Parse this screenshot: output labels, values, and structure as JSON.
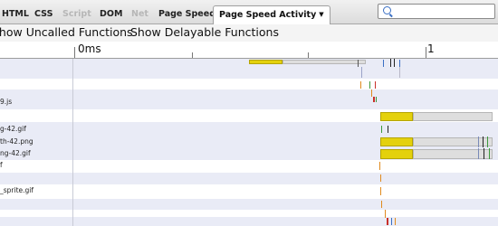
{
  "tabs": [
    {
      "label": "HTML",
      "state": "normal"
    },
    {
      "label": "CSS",
      "state": "normal"
    },
    {
      "label": "Script",
      "state": "disabled"
    },
    {
      "label": "DOM",
      "state": "normal"
    },
    {
      "label": "Net",
      "state": "disabled"
    },
    {
      "label": "Page Speed",
      "state": "normal"
    },
    {
      "label": "Page Speed Activity",
      "state": "selected"
    }
  ],
  "search": {
    "value": ""
  },
  "options": [
    {
      "label": "Show Uncalled Functions"
    },
    {
      "label": "Show Delayable Functions"
    }
  ],
  "timeline": {
    "start_label": "0ms",
    "end_label": "1",
    "rows": [
      {
        "name": ""
      },
      {
        "name": ""
      },
      {
        "name": ""
      },
      {
        "name": "9.js"
      },
      {
        "name": ""
      },
      {
        "name": "g-42.gif"
      },
      {
        "name": ""
      },
      {
        "name": "th-42.png"
      },
      {
        "name": "ng-42.gif"
      },
      {
        "name": "f"
      },
      {
        "name": ""
      },
      {
        "name": "_sprite.gif"
      },
      {
        "name": ""
      },
      {
        "name": ""
      },
      {
        "name": ""
      }
    ]
  },
  "colors": {
    "load_bar": "#e4d10c",
    "wait_bar": "#dedede",
    "row_stripe": "#e9ebf6",
    "marker_orange": "#e08a1e",
    "marker_red": "#c8302a",
    "marker_green": "#3c9a3c",
    "marker_blue": "#4a6fc4",
    "marker_dark": "#222222"
  }
}
